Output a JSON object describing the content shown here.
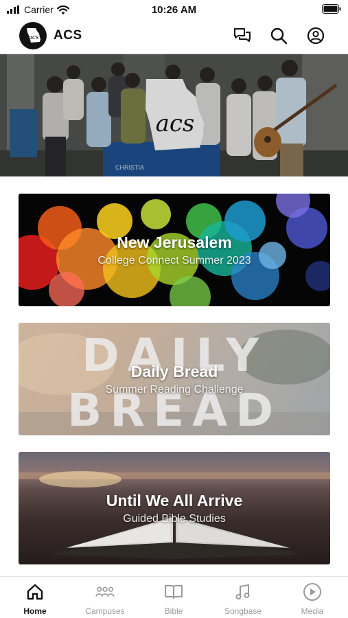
{
  "status_bar": {
    "carrier": "Carrier",
    "time": "10:26 AM"
  },
  "header": {
    "title": "ACS",
    "logo_text": "acs"
  },
  "hero": {
    "logo_text": "acs",
    "banner_text": "CHRISTIA"
  },
  "cards": [
    {
      "title": "New Jerusalem",
      "subtitle": "College Connect Summer 2023"
    },
    {
      "title": "Daily Bread",
      "subtitle": "Summer Reading Challenge",
      "background_text_1": "DAILY",
      "background_text_2": "BREAD"
    },
    {
      "title": "Until We All Arrive",
      "subtitle": "Guided Bible Studies"
    }
  ],
  "tabs": [
    {
      "label": "Home",
      "icon": "home-icon",
      "active": true
    },
    {
      "label": "Campuses",
      "icon": "people-icon",
      "active": false
    },
    {
      "label": "Bible",
      "icon": "book-icon",
      "active": false
    },
    {
      "label": "Songbase",
      "icon": "music-note-icon",
      "active": false
    },
    {
      "label": "Media",
      "icon": "play-icon",
      "active": false
    }
  ],
  "colors": {
    "active_tab": "#111111",
    "inactive_tab": "#9a9a9a",
    "header_border": "#e5e5e5"
  }
}
